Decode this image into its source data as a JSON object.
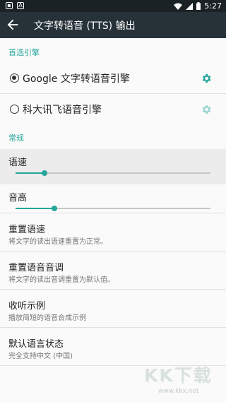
{
  "status_bar": {
    "time": "5:27"
  },
  "app_bar": {
    "title": "文字转语音 (TTS) 输出"
  },
  "preferred_engine": {
    "header": "首选引擎",
    "engines": [
      {
        "label": "Google 文字转语音引擎",
        "selected": true
      },
      {
        "label": "科大讯飞语音引擎",
        "selected": false
      }
    ]
  },
  "general": {
    "header": "常规",
    "speech_rate": {
      "label": "语速",
      "value": 0.15
    },
    "pitch": {
      "label": "音高",
      "value": 0.2
    },
    "items": [
      {
        "title": "重置语速",
        "subtitle": "将文字的读出语速重置为正常。"
      },
      {
        "title": "重置语音音调",
        "subtitle": "将文字的读出音调重置为默认值。"
      },
      {
        "title": "收听示例",
        "subtitle": "播放简短的语音合成示例"
      },
      {
        "title": "默认语言状态",
        "subtitle": "完全支持中文 (中国)"
      }
    ]
  },
  "watermark": {
    "text": "KK下载",
    "url": "www.kkx.net"
  },
  "colors": {
    "accent": "#26a69a",
    "appbar": "#263238",
    "statusbar": "#1a2226"
  }
}
